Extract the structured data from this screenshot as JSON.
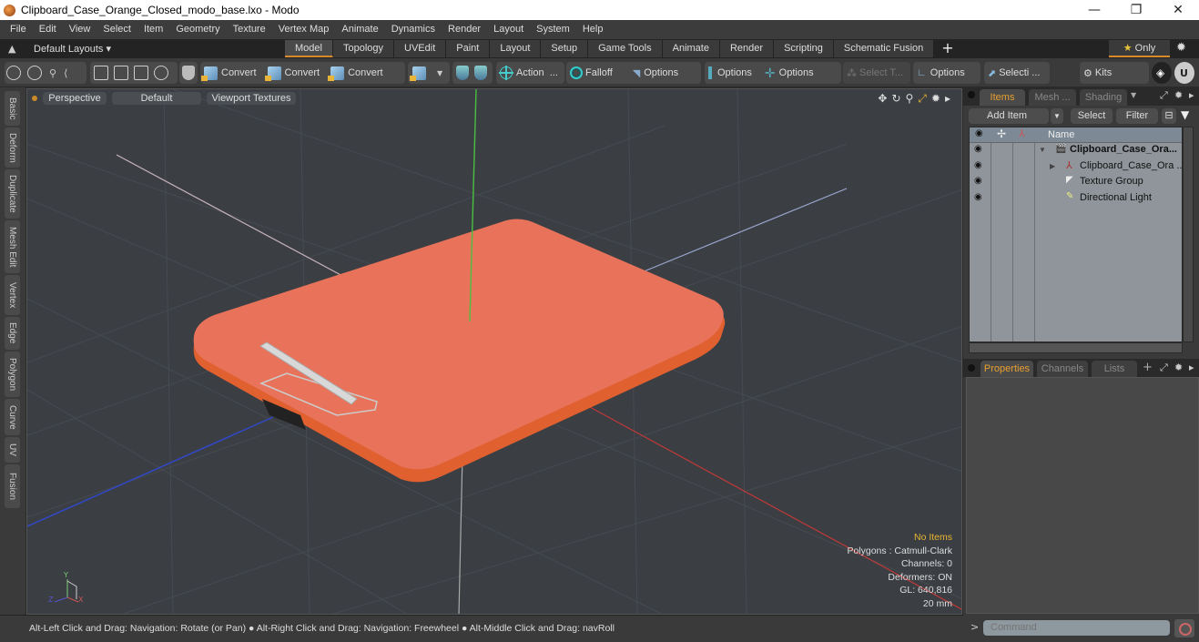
{
  "window": {
    "title": "Clipboard_Case_Orange_Closed_modo_base.lxo - Modo",
    "controls": {
      "minimize": "—",
      "restore": "❐",
      "close": "✕"
    }
  },
  "menu": [
    "File",
    "Edit",
    "View",
    "Select",
    "Item",
    "Geometry",
    "Texture",
    "Vertex Map",
    "Animate",
    "Dynamics",
    "Render",
    "Layout",
    "System",
    "Help"
  ],
  "layout_bar": {
    "layouts_label": "Default Layouts ▾",
    "tabs": [
      "Model",
      "Topology",
      "UVEdit",
      "Paint",
      "Layout",
      "Setup",
      "Game Tools",
      "Animate",
      "Render",
      "Scripting",
      "Schematic Fusion"
    ],
    "active_tab": "Model",
    "add_label": "+",
    "only_label": "Only",
    "only_icon": "★"
  },
  "toolbar": {
    "convert_1": "Convert",
    "convert_2": "Convert",
    "convert_3": "Convert",
    "action": "Action",
    "action_more": "...",
    "falloff": "Falloff",
    "options_1": "Options",
    "options_2": "Options",
    "options_3": "Options",
    "select_t": "Select T...",
    "options_4": "Options",
    "selecti": "Selecti ...",
    "kits": "Kits"
  },
  "left_tabs": [
    "Basic",
    "Deform",
    "Duplicate",
    "Mesh Edit",
    "Vertex",
    "Edge",
    "Polygon",
    "Curve",
    "UV",
    "Fusion"
  ],
  "viewport": {
    "view_mode": "Perspective",
    "shading": "Default",
    "textures": "Viewport Textures",
    "overlay": {
      "no_items": "No Items",
      "polygons": "Polygons : Catmull-Clark",
      "channels": "Channels: 0",
      "deformers": "Deformers: ON",
      "gl": "GL: 640,816",
      "scale": "20 mm"
    },
    "axis_labels": {
      "y": "Y",
      "z": "Z",
      "x": "X"
    },
    "model_color": "#e8704a"
  },
  "status_bar": {
    "message": "Alt-Left Click and Drag: Navigation: Rotate (or Pan) ● Alt-Right Click and Drag: Navigation: Freewheel ● Alt-Middle Click and Drag: navRoll"
  },
  "items_panel": {
    "tabs": [
      "Items",
      "Mesh ...",
      "Shading"
    ],
    "active_tab": "Items",
    "add_item": "Add Item",
    "select": "Select",
    "filter": "Filter",
    "column_name": "Name",
    "rows": [
      {
        "name": "Clipboard_Case_Ora...",
        "icon": "scene-icon",
        "bold": true,
        "expander": "▼"
      },
      {
        "name": "Clipboard_Case_Ora ...",
        "icon": "mesh-icon",
        "bold": false,
        "expander": "▶"
      },
      {
        "name": "Texture Group",
        "icon": "texture-group-icon",
        "bold": false,
        "expander": ""
      },
      {
        "name": "Directional Light",
        "icon": "light-icon",
        "bold": false,
        "expander": ""
      }
    ]
  },
  "properties_panel": {
    "tabs": [
      "Properties",
      "Channels",
      "Lists"
    ],
    "active_tab": "Properties",
    "add": "+"
  },
  "command": {
    "placeholder": "Command",
    "prompt": ">"
  },
  "colors": {
    "accent": "#e8a030",
    "active_tab_underline": "#d88a2a"
  }
}
